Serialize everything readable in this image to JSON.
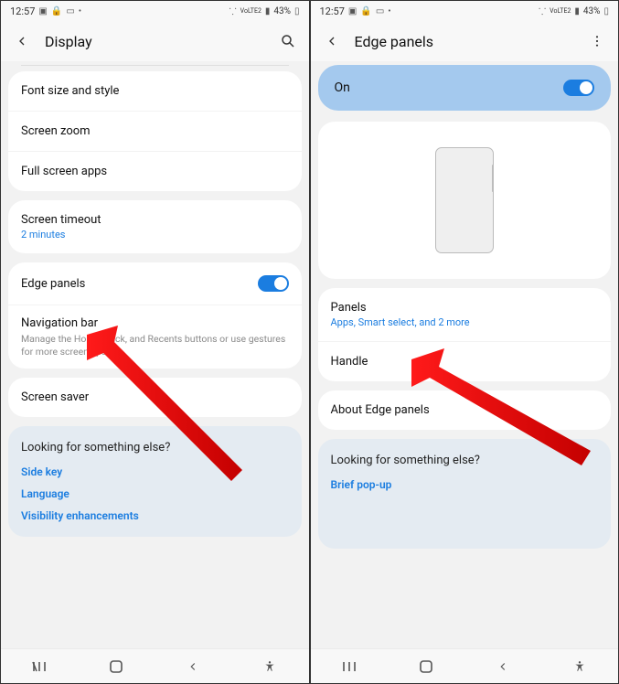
{
  "statusbar": {
    "time": "12:57",
    "battery": "43%",
    "net": "VoLTE2"
  },
  "left": {
    "title": "Display",
    "rows": {
      "font": "Font size and style",
      "zoom": "Screen zoom",
      "fullscreen": "Full screen apps",
      "timeout": "Screen timeout",
      "timeout_sub": "2 minutes",
      "edge": "Edge panels",
      "nav": "Navigation bar",
      "nav_desc": "Manage the Home, Back, and Recents buttons or use gestures for more screen space.",
      "saver": "Screen saver"
    },
    "suggest": {
      "q": "Looking for something else?",
      "links": [
        "Side key",
        "Language",
        "Visibility enhancements"
      ]
    }
  },
  "right": {
    "title": "Edge panels",
    "master": "On",
    "rows": {
      "panels": "Panels",
      "panels_sub": "Apps, Smart select, and 2 more",
      "handle": "Handle",
      "about": "About Edge panels"
    },
    "suggest": {
      "q": "Looking for something else?",
      "links": [
        "Brief pop-up"
      ]
    }
  }
}
